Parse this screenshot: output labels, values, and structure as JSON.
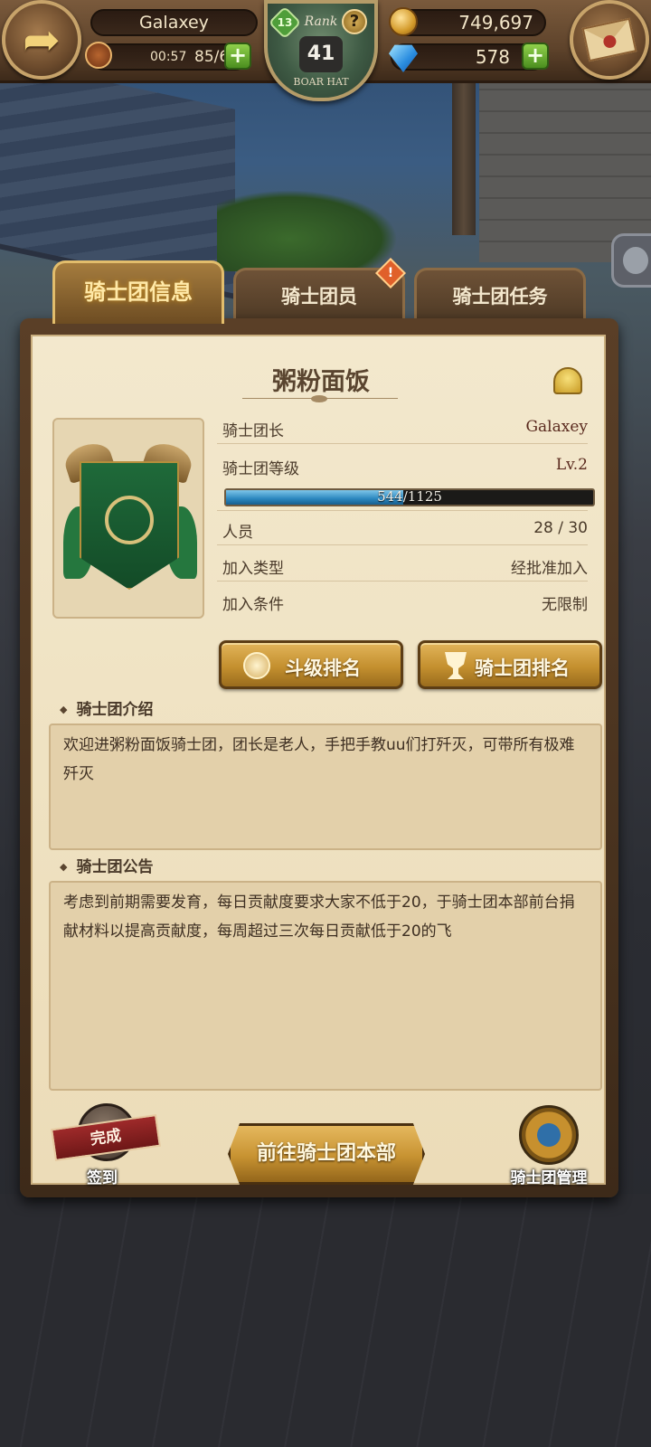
{
  "topbar": {
    "player_name": "Galaxey",
    "stamina_timer": "00:57",
    "stamina": "85/60",
    "rank_label": "Rank",
    "rank_level": "41",
    "rank_sub": "BOAR HAT",
    "rank_tier": "13",
    "gold": "749,697",
    "gems": "578"
  },
  "tabs": {
    "info": "骑士团信息",
    "members": "骑士团员",
    "tasks": "骑士团任务",
    "members_alert": "!"
  },
  "guild": {
    "name": "粥粉面饭",
    "leader_label": "骑士团长",
    "leader_value": "Galaxey",
    "level_label": "骑士团等级",
    "level_value": "Lv.2",
    "xp_text": "544/1125",
    "xp_fraction": 0.4836,
    "members_label": "人员",
    "members_value": "28 / 30",
    "join_type_label": "加入类型",
    "join_type_value": "经批准加入",
    "join_cond_label": "加入条件",
    "join_cond_value": "无限制"
  },
  "buttons": {
    "fight_rank": "斗级排名",
    "guild_rank": "骑士团排名",
    "go_hq": "前往骑士团本部",
    "signin_done": "完成",
    "signin": "签到",
    "manage": "骑士团管理"
  },
  "intro": {
    "title": "骑士团介绍",
    "text": "欢迎进粥粉面饭骑士团，团长是老人，手把手教uu们打歼灭，可带所有极难歼灭"
  },
  "notice": {
    "title": "骑士团公告",
    "text": "考虑到前期需要发育，每日贡献度要求大家不低于20，于骑士团本部前台捐献材料以提高贡献度，每周超过三次每日贡献低于20的飞"
  },
  "icons": [
    "back-arrow-icon",
    "mail-icon",
    "stamina-icon",
    "gold-coin-icon",
    "gem-icon",
    "help-icon",
    "bell-icon",
    "medal-icon",
    "trophy-icon",
    "guild-emblem",
    "signin-icon",
    "manage-gear-icon"
  ]
}
